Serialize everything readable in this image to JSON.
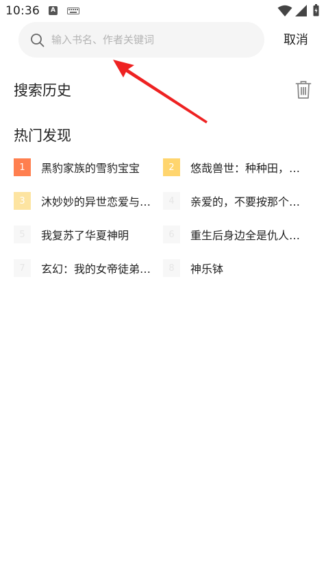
{
  "status_bar": {
    "time": "10:36",
    "a_icon_letter": "A",
    "icons": [
      "a-notification-icon",
      "keyboard-icon",
      "wifi-icon",
      "signal-icon",
      "battery-icon"
    ]
  },
  "search": {
    "placeholder": "输入书名、作者关键词",
    "value": "",
    "cancel_label": "取消"
  },
  "history": {
    "title": "搜索历史",
    "clear_icon": "trash-icon"
  },
  "hot": {
    "title": "热门发现",
    "items": [
      {
        "rank": "1",
        "title": "黑豹家族的雪豹宝宝"
      },
      {
        "rank": "2",
        "title": "悠哉兽世：种种田，生生崽"
      },
      {
        "rank": "3",
        "title": "沐妙妙的异世恋爱与婚约"
      },
      {
        "rank": "4",
        "title": "亲爱的，不要按那个按钮"
      },
      {
        "rank": "5",
        "title": "我复苏了华夏神明"
      },
      {
        "rank": "6",
        "title": "重生后身边全是仇人的孩子"
      },
      {
        "rank": "7",
        "title": "玄幻：我的女帝徒弟太宠我"
      },
      {
        "rank": "8",
        "title": "神乐钵"
      }
    ]
  },
  "colors": {
    "rank_1": "#ff7f4f",
    "rank_2": "#ffd56e",
    "rank_3": "#fde4a1",
    "rank_other": "#f7f7f7",
    "rank_other_text": "#e6e6e6",
    "arrow": "#ee2222"
  }
}
